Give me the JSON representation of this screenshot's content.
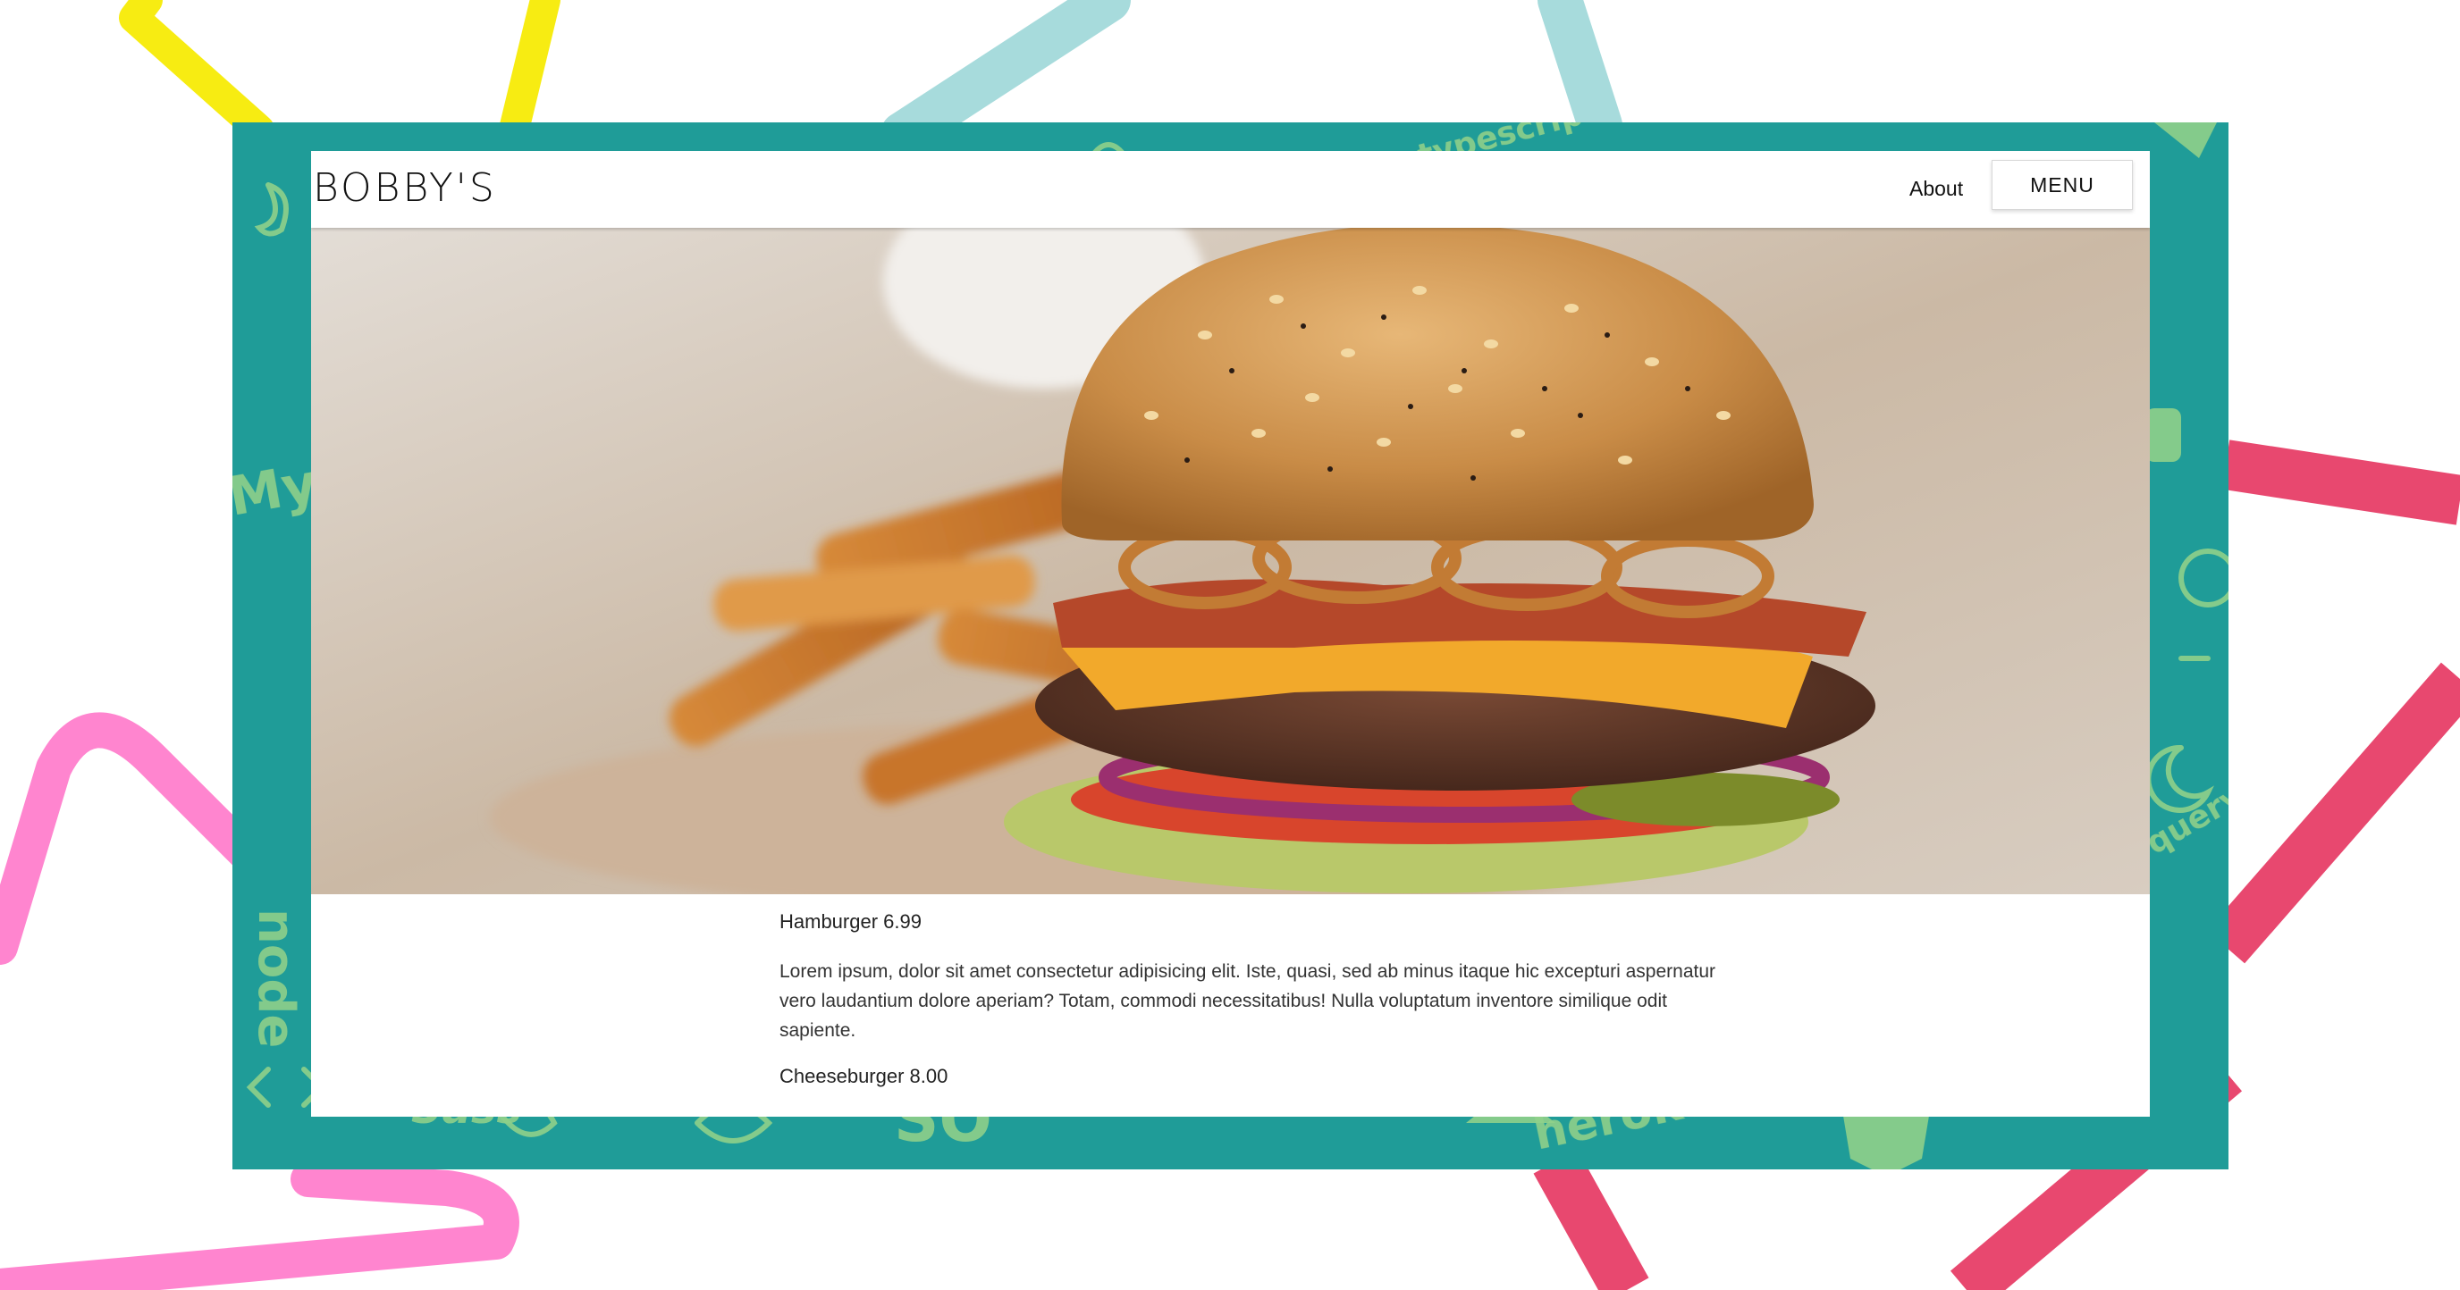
{
  "brand": {
    "name": "BOBBY'S"
  },
  "nav": {
    "about_label": "About",
    "menu_label": "MENU"
  },
  "hero": {
    "image_alt": "Burger with fries",
    "icon": "hero-image"
  },
  "menu_items": [
    {
      "title": "Hamburger 6.99",
      "description": "Lorem ipsum, dolor sit amet consectetur adipisicing elit. Iste, quasi, sed ab minus itaque hic excepturi aspernatur vero laudantium dolore aperiam? Totam, commodi necessitatibus! Nulla voluptatum inventore similique odit sapiente."
    },
    {
      "title": "Cheeseburger 8.00"
    }
  ],
  "colors": {
    "frame": "#1f9c98",
    "pattern": "#8fd08a",
    "yellow": "#f7ec12",
    "teal_light": "#a7dbdc",
    "pink": "#ff85cf",
    "red": "#e8486f"
  }
}
